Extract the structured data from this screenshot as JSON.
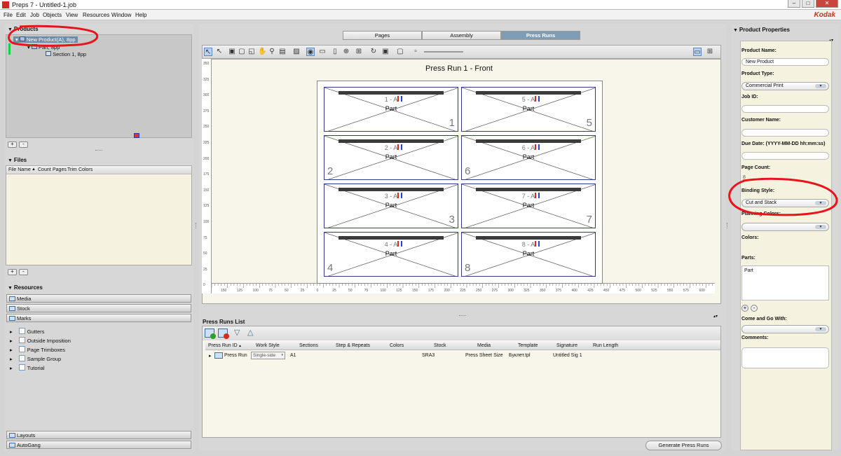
{
  "window": {
    "title": "Preps 7 - Untitled-1.job",
    "minimize": "–",
    "maximize": "□",
    "close": "✕"
  },
  "menu": {
    "items": [
      "File",
      "Edit",
      "Job",
      "Objects",
      "View",
      "Resources",
      "Window",
      "Help"
    ],
    "brand": "Kodak"
  },
  "products": {
    "header": "Products",
    "tree": [
      {
        "label": "New Product(A), 8pp",
        "selected": true
      },
      {
        "label": "Part, 8pp"
      },
      {
        "label": "Section 1, 8pp"
      }
    ],
    "add": "+",
    "remove": "-"
  },
  "files": {
    "header": "Files",
    "columns": [
      "File Name",
      "Count",
      "Pages",
      "Trim",
      "Colors"
    ],
    "add": "+",
    "remove": "-"
  },
  "resources": {
    "header": "Resources",
    "bars": [
      "Media",
      "Stock",
      "Marks"
    ],
    "marks": [
      "Gutters",
      "Outside Imposition",
      "Page Trimboxes",
      "Sample Group",
      "Tutorial"
    ],
    "bottom_bars": [
      "Layouts",
      "AutoGang"
    ]
  },
  "tabs": [
    {
      "label": "Pages"
    },
    {
      "label": "Assembly"
    },
    {
      "label": "Press Runs",
      "active": true
    }
  ],
  "canvas": {
    "title": "Press Run 1 - Front",
    "vertical_ruler": [
      "350",
      "325",
      "300",
      "275",
      "250",
      "225",
      "200",
      "175",
      "150",
      "125",
      "100",
      "75",
      "50",
      "25",
      "0"
    ],
    "horizontal_ruler": [
      "150",
      "125",
      "100",
      "75",
      "50",
      "25",
      "0",
      "25",
      "50",
      "75",
      "100",
      "125",
      "150",
      "175",
      "200",
      "225",
      "250",
      "275",
      "300",
      "325",
      "350",
      "375",
      "400",
      "425",
      "450",
      "475",
      "500",
      "525",
      "550",
      "575",
      "600"
    ],
    "pages": [
      {
        "label": "1 - A",
        "name": "Part",
        "number": "1"
      },
      {
        "label": "5 - A",
        "name": "Part",
        "number": "5"
      },
      {
        "label": "2 - A",
        "name": "Part",
        "number": "2"
      },
      {
        "label": "6 - A",
        "name": "Part",
        "number": "6"
      },
      {
        "label": "3 - A",
        "name": "Part",
        "number": "3"
      },
      {
        "label": "7 - A",
        "name": "Part",
        "number": "7"
      },
      {
        "label": "4 - A",
        "name": "Part",
        "number": "4"
      },
      {
        "label": "8 - A",
        "name": "Part",
        "number": "8"
      }
    ]
  },
  "press_runs_list": {
    "header": "Press Runs List",
    "columns": [
      "Press Run ID",
      "Work Style",
      "Sections",
      "Step & Repeats",
      "Colors",
      "Stock",
      "Media",
      "Template",
      "Signature",
      "Run Length"
    ],
    "rows": [
      {
        "id": "Press Run",
        "work_style": "Single-side",
        "sections": "A1",
        "stock": "SRA3",
        "media": "Press Sheet Size",
        "template": "Буклет.tpl",
        "signature": "Untitled Sig 1"
      }
    ],
    "generate_button": "Generate Press Runs"
  },
  "product_properties": {
    "header": "Product Properties",
    "product_name_label": "Product Name:",
    "product_name_value": "New Product",
    "product_type_label": "Product Type:",
    "product_type_value": "Commercial Print",
    "job_id_label": "Job ID:",
    "customer_name_label": "Customer Name:",
    "due_date_label": "Due Date: (YYYY-MM-DD hh:mm:ss)",
    "page_count_label": "Page Count:",
    "page_count_value": "8",
    "binding_style_label": "Binding Style:",
    "binding_style_value": "Cut and Stack",
    "planning_colors_label": "Planning Colors:",
    "colors_label": "Colors:",
    "parts_label": "Parts:",
    "parts_items": [
      "Part"
    ],
    "come_and_go_label": "Come and Go With:",
    "comments_label": "Comments:"
  },
  "annotation_color": "#e8141c"
}
